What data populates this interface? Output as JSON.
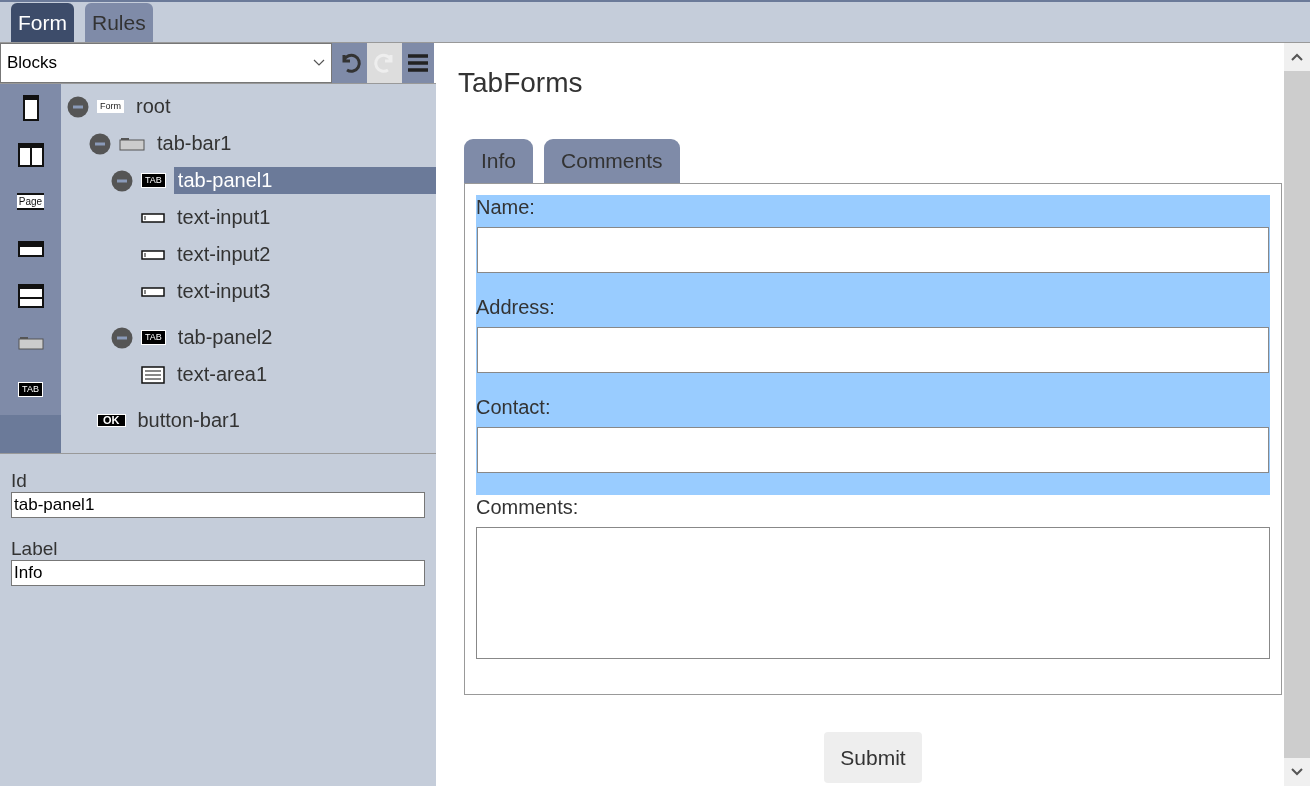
{
  "top_tabs": [
    {
      "label": "Form",
      "selected": true
    },
    {
      "label": "Rules",
      "selected": false
    }
  ],
  "toolbar": {
    "select_value": "Blocks"
  },
  "palette": [
    {
      "kind": "phone"
    },
    {
      "kind": "columns"
    },
    {
      "kind": "page",
      "label": "Page"
    },
    {
      "kind": "header"
    },
    {
      "kind": "rows"
    },
    {
      "kind": "tabbar"
    },
    {
      "kind": "tab",
      "label": "TAB"
    }
  ],
  "tree": [
    {
      "label": "root",
      "kind": "form",
      "badge": "Form",
      "selected": false,
      "children": [
        {
          "label": "tab-bar1",
          "kind": "tabbar",
          "selected": false,
          "children": [
            {
              "label": "tab-panel1",
              "kind": "tab",
              "badge": "TAB",
              "selected": true,
              "children": [
                {
                  "label": "text-input1",
                  "kind": "input",
                  "selected": false
                },
                {
                  "label": "text-input2",
                  "kind": "input",
                  "selected": false
                },
                {
                  "label": "text-input3",
                  "kind": "input",
                  "selected": false
                }
              ]
            },
            {
              "label": "tab-panel2",
              "kind": "tab",
              "badge": "TAB",
              "selected": false,
              "children": [
                {
                  "label": "text-area1",
                  "kind": "textarea",
                  "selected": false
                }
              ]
            }
          ]
        },
        {
          "label": "button-bar1",
          "kind": "ok",
          "badge": "OK",
          "selected": false
        }
      ]
    }
  ],
  "properties": [
    {
      "label": "Id",
      "value": "tab-panel1"
    },
    {
      "label": "Label",
      "value": "Info"
    }
  ],
  "preview": {
    "title": "TabForms",
    "tabs": [
      {
        "label": "Info"
      },
      {
        "label": "Comments"
      }
    ],
    "fields": [
      {
        "label": "Name:",
        "kind": "input",
        "highlighted": true
      },
      {
        "label": "Address:",
        "kind": "input",
        "highlighted": true
      },
      {
        "label": "Contact:",
        "kind": "input",
        "highlighted": true
      },
      {
        "label": "Comments:",
        "kind": "textarea",
        "highlighted": false
      }
    ],
    "submit": "Submit"
  }
}
